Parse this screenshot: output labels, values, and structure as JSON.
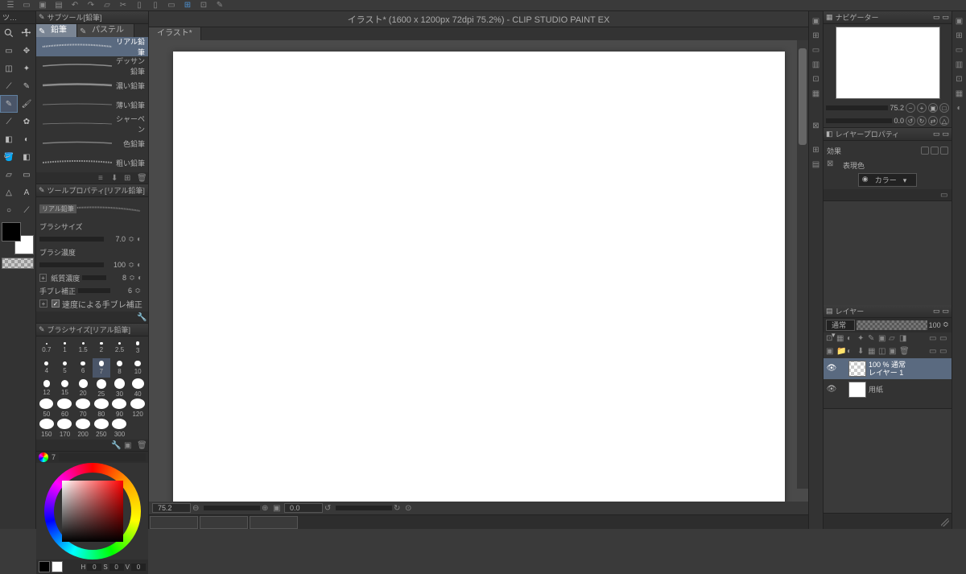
{
  "title": "イラスト* (1600 x 1200px 72dpi 75.2%)   - CLIP STUDIO PAINT EX",
  "doc_tab": "イラスト*",
  "toolcol_hdr": "ツ…",
  "subtool": {
    "hdr": "サブツール[鉛筆]",
    "tabs": [
      "鉛筆",
      "パステル"
    ],
    "items": [
      "リアル鉛筆",
      "デッサン鉛筆",
      "濃い鉛筆",
      "薄い鉛筆",
      "シャーペン",
      "色鉛筆",
      "粗い鉛筆"
    ]
  },
  "toolprop": {
    "hdr": "ツールプロパティ[リアル鉛筆]",
    "preview_label": "リアル鉛筆",
    "rows": {
      "brush_size": {
        "label": "ブラシサイズ",
        "value": "7.0"
      },
      "density": {
        "label": "ブラシ濃度",
        "value": "100"
      },
      "paper": {
        "label": "紙質濃度",
        "value": "8"
      },
      "stabilize": {
        "label": "手ブレ補正",
        "value": "6"
      },
      "speed_check": {
        "checked": true,
        "label": "速度による手ブレ補正"
      }
    }
  },
  "brushsize": {
    "hdr": "ブラシサイズ[リアル鉛筆]",
    "selected": 7,
    "sizes": [
      0.7,
      1,
      1.5,
      2,
      2.5,
      3,
      4,
      5,
      6,
      7,
      8,
      10,
      12,
      15,
      20,
      25,
      30,
      40,
      50,
      60,
      70,
      80,
      90,
      120,
      150,
      170,
      200,
      250,
      300
    ]
  },
  "color_indicator": "7",
  "swatch": {
    "h": "H",
    "hv": "0",
    "s": "S",
    "sv": "0",
    "v": "V",
    "vv": "0"
  },
  "nav": {
    "hdr": "ナビゲーター",
    "zoom": "75.2",
    "rotate": "0.0"
  },
  "layerprop": {
    "hdr": "レイヤープロパティ",
    "effect": "効果",
    "expr": "表現色",
    "mode": "カラー"
  },
  "layers": {
    "hdr": "レイヤー",
    "blend": "通常",
    "opacity": "100",
    "layer1_blend": "100 % 通常",
    "layer1": "レイヤー 1",
    "paper": "用紙"
  },
  "bottom": {
    "zoom": "75.2",
    "rotate": "0.0"
  }
}
